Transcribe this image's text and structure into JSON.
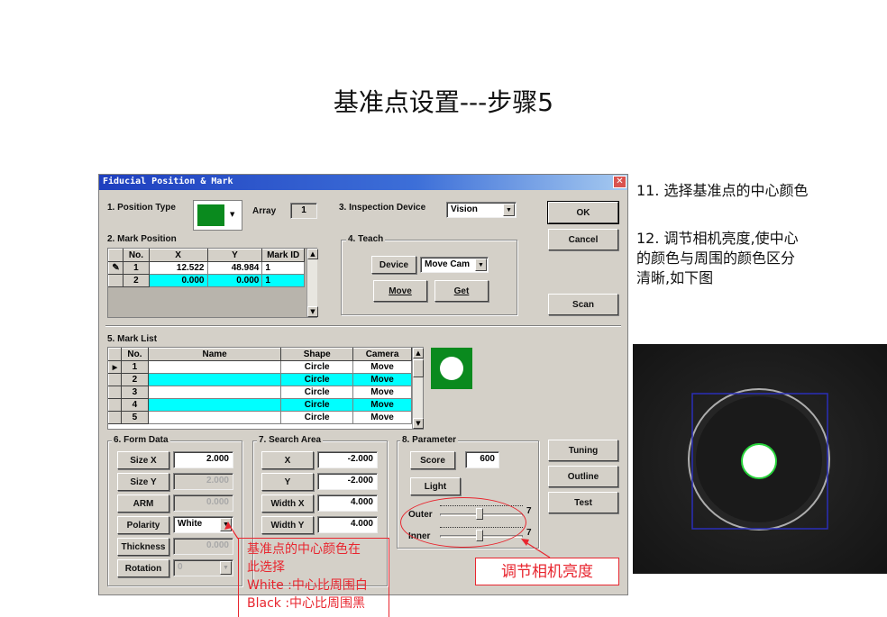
{
  "slide_title": "基准点设置---步骤5",
  "dialog": {
    "title": "Fiducial Position & Mark",
    "close_glyph": "✕",
    "position_type_label": "1. Position Type",
    "array_label": "Array",
    "array_value": "1",
    "inspection_device_label": "3. Inspection Device",
    "inspection_device_value": "Vision",
    "ok_label": "OK",
    "cancel_label": "Cancel",
    "scan_label": "Scan",
    "mark_position": {
      "label": "2. Mark Position",
      "headers": [
        "No.",
        "X",
        "Y",
        "Mark ID"
      ],
      "rows": [
        {
          "no": "1",
          "x": "12.522",
          "y": "48.984",
          "mark_id": "1",
          "marker": "✎"
        },
        {
          "no": "2",
          "x": "0.000",
          "y": "0.000",
          "mark_id": "1",
          "marker": ""
        }
      ]
    },
    "teach": {
      "label": "4. Teach",
      "device_label": "Device",
      "device_value": "Move Cam",
      "move_label": "Move",
      "get_label": "Get"
    },
    "mark_list": {
      "label": "5. Mark List",
      "headers": [
        "No.",
        "Name",
        "Shape",
        "Camera"
      ],
      "rows": [
        {
          "no": "1",
          "name": "",
          "shape": "Circle",
          "camera": "Move",
          "marker": "▶"
        },
        {
          "no": "2",
          "name": "",
          "shape": "Circle",
          "camera": "Move",
          "marker": ""
        },
        {
          "no": "3",
          "name": "",
          "shape": "Circle",
          "camera": "Move",
          "marker": ""
        },
        {
          "no": "4",
          "name": "",
          "shape": "Circle",
          "camera": "Move",
          "marker": ""
        },
        {
          "no": "5",
          "name": "",
          "shape": "Circle",
          "camera": "Move",
          "marker": ""
        }
      ]
    },
    "form_data": {
      "label": "6. Form Data",
      "size_x_label": "Size X",
      "size_x": "2.000",
      "size_y_label": "Size Y",
      "size_y": "2.000",
      "arm_label": "ARM",
      "arm": "0.000",
      "polarity_label": "Polarity",
      "polarity": "White",
      "thickness_label": "Thickness",
      "thickness": "0.000",
      "rotation_label": "Rotation",
      "rotation": "0"
    },
    "search_area": {
      "label": "7. Search Area",
      "x_label": "X",
      "x": "-2.000",
      "y_label": "Y",
      "y": "-2.000",
      "width_x_label": "Width X",
      "width_x": "4.000",
      "width_y_label": "Width Y",
      "width_y": "4.000"
    },
    "parameter": {
      "label": "8. Parameter",
      "score_label": "Score",
      "score": "600",
      "light_label": "Light",
      "outer_label": "Outer",
      "outer_value": "7",
      "inner_label": "Inner",
      "inner_value": "7"
    },
    "tuning_label": "Tuning",
    "outline_label": "Outline",
    "test_label": "Test"
  },
  "annotations": {
    "step11": "11. 选择基准点的中心颜色",
    "step12": [
      "12. 调节相机亮度,使中心",
      "的颜色与周围的颜色区分",
      "清晰,如下图"
    ],
    "polarity_note": [
      "基准点的中心颜色在",
      "此选择",
      "White :中心比周围白",
      "Black :中心比周围黑"
    ],
    "brightness_note": "调节相机亮度"
  },
  "colors": {
    "titlebar": "#1e3fbf",
    "row_highlight": "#00ffff",
    "mark_green": "#0a8a1e",
    "annotation_red": "#e8262f"
  }
}
